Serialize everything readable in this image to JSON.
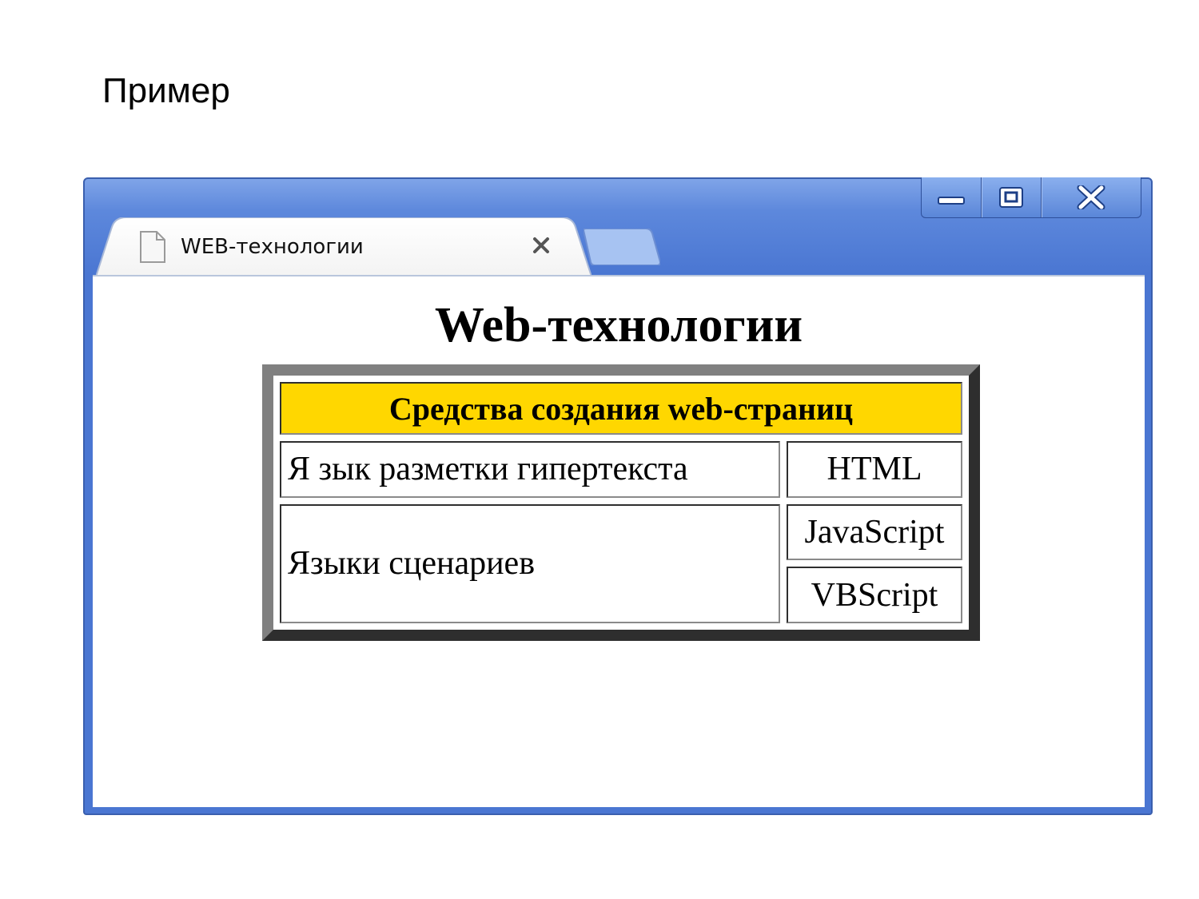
{
  "slide": {
    "title": "Пример"
  },
  "browser": {
    "tab_title": "WEB-технологии",
    "tab_close_icon": "close-icon",
    "page_icon": "document-icon",
    "controls": {
      "minimize_icon": "minimize-icon",
      "maximize_icon": "maximize-icon",
      "close_icon": "close-icon"
    },
    "frame_color": "#4a76d2"
  },
  "page": {
    "heading": "Web-технологии",
    "table": {
      "header": "Средства создания web-страниц",
      "header_bg": "#ffd700",
      "rows": [
        {
          "left": "Я зык разметки гипертекста",
          "right": [
            "HTML"
          ]
        },
        {
          "left": "Языки сценариев",
          "right": [
            "JavaScript",
            "VBScript"
          ]
        }
      ]
    }
  }
}
